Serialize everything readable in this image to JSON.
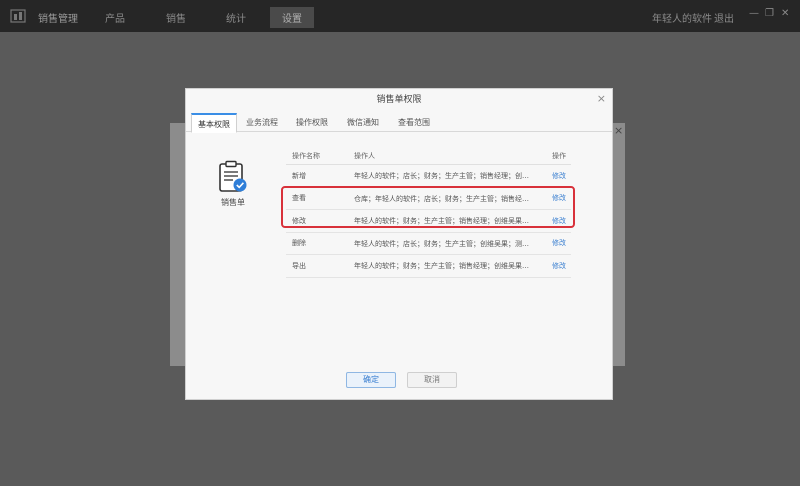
{
  "topbar": {
    "app_title": "销售管理",
    "nav": [
      "产品",
      "销售",
      "统计",
      "设置"
    ],
    "active_nav": 3,
    "user": "年轻人的软件",
    "logout": "退出",
    "window_controls": [
      "—",
      "❐",
      "✕"
    ]
  },
  "dialog": {
    "title": "销售单权限",
    "close": "×",
    "tabs": [
      "基本权限",
      "业务流程",
      "操作权限",
      "微信通知",
      "查看范围"
    ],
    "active_tab": 0,
    "doc_label": "销售单",
    "table": {
      "headers": [
        "操作名称",
        "操作人",
        "操作"
      ],
      "rows": [
        {
          "name": "新增",
          "operators": "年轻人的软件；店长；财务；生产主管；销售经理；创维吴果；测试账号",
          "action": "修改"
        },
        {
          "name": "查看",
          "operators": "仓库；年轻人的软件；店长；财务；生产主管；销售经理；...",
          "action": "修改"
        },
        {
          "name": "修改",
          "operators": "年轻人的软件；财务；生产主管；销售经理；创维吴果；测试账号",
          "action": "修改"
        },
        {
          "name": "删除",
          "operators": "年轻人的软件；店长；财务；生产主管；创维吴果；测试账号",
          "action": "修改"
        },
        {
          "name": "导出",
          "operators": "年轻人的软件；财务；生产主管；销售经理；创维吴果；测试账号",
          "action": "修改"
        }
      ]
    },
    "ok_label": "确定",
    "cancel_label": "取消"
  },
  "colors": {
    "accent": "#3a7fd0",
    "highlight": "#d8313a"
  }
}
